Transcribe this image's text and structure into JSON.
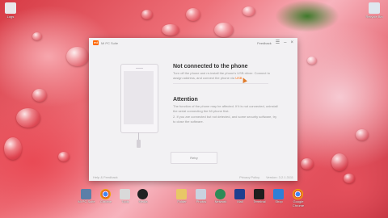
{
  "desktop": {
    "top_right_icon_label": "Recycle Bin",
    "top_left_icon_label": "Logs"
  },
  "window": {
    "app_name": "Mi PC Suite",
    "feedback_link": "Feedback",
    "settings_label": "Settings",
    "heading_not_connected": "Not connected to the phone",
    "body_not_connected": "Turn off the phone and re-install the phone's USB driver. Connect to assign address, and connect the phone via",
    "link_text": "USB",
    "heading_attention": "Attention",
    "attention_1": "The function of the phone may be affected. If it is not connected, uninstall the serial connecting the Mi phone first.",
    "attention_2": "2. If you are connected but not detected, and some security software, try to close the software.",
    "retry_button": "Retry",
    "footer_left": "Help & Feedback",
    "footer_mid": "Privacy Policy",
    "footer_right": "Version: 3.2.1.3111"
  },
  "taskbar_items": [
    {
      "label": "Mi PC Suite"
    },
    {
      "label": "Chrome"
    },
    {
      "label": "Tools"
    },
    {
      "label": "Media"
    },
    {
      "label": "Folder"
    },
    {
      "label": "Photos"
    },
    {
      "label": "Network"
    },
    {
      "label": "Mail"
    },
    {
      "label": "Terminal"
    },
    {
      "label": "Shop"
    },
    {
      "label": "Google Chrome"
    }
  ],
  "colors": {
    "accent": "#ff6700",
    "window_bg": "#f2f1f3"
  }
}
